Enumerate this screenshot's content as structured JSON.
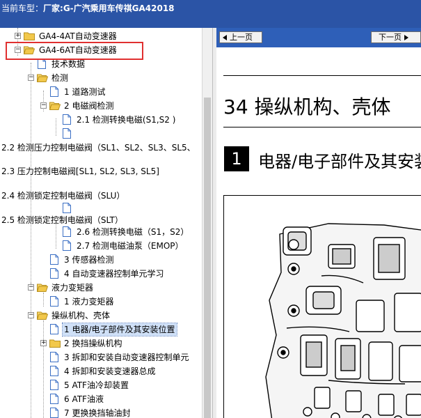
{
  "window": {
    "caption_label": "当前车型：",
    "caption_value": "厂家:G-广汽乘用车传祺GA42018"
  },
  "tree": {
    "nodes": [
      {
        "label": "GA4-4AT自动变速器"
      },
      {
        "label": "GA4-6AT自动变速器"
      },
      {
        "label": "技术数据"
      },
      {
        "label": "检测"
      },
      {
        "label": "1 道路测试"
      },
      {
        "label": "2 电磁阀检测"
      },
      {
        "label": "2.1 检测转换电磁(S1,S2 )"
      },
      {
        "label": ""
      },
      {
        "label": "2.2 检测压力控制电磁阀（SL1、SL2、SL3、SL5、"
      },
      {
        "label": "2.3 压力控制电磁阀[SL1, SL2, SL3, SL5]"
      },
      {
        "label": "2.4 检测锁定控制电磁阀（SLU）"
      },
      {
        "label": ""
      },
      {
        "label": "2.5 检测锁定控制电磁阀（SLT）"
      },
      {
        "label": "2.6 检测转换电磁（S1，S2）"
      },
      {
        "label": "2.7 检测电磁油泵（EMOP）"
      },
      {
        "label": "3 传感器检测"
      },
      {
        "label": "4 自动变速器控制单元学习"
      },
      {
        "label": "液力变矩器"
      },
      {
        "label": "1 液力变矩器"
      },
      {
        "label": "操纵机构、壳体"
      },
      {
        "label": "1 电器/电子部件及其安装位置"
      },
      {
        "label": "2 换挡操纵机构"
      },
      {
        "label": "3 拆卸和安装自动变速器控制单元"
      },
      {
        "label": "4 拆卸和安装变速器总成"
      },
      {
        "label": "5 ATF油冷却装置"
      },
      {
        "label": "6 ATF油液"
      },
      {
        "label": "7 更换换挡轴油封"
      }
    ]
  },
  "doc": {
    "prev_label": "上一页",
    "next_label": "下一页",
    "section_title": "34 操纵机构、壳体",
    "subsection_number": "1",
    "subsection_title": "电器/电子部件及其安装位置",
    "figure_icon": "valve-body-diagram"
  },
  "colors": {
    "titlebar": "#2b54a6",
    "navbar": "#2e5fb8",
    "highlight": "#e03030",
    "selection": "#cfe0f7",
    "folder": "#f2c84b"
  }
}
